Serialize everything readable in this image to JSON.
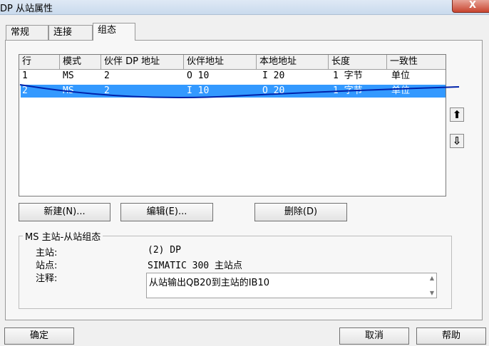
{
  "window": {
    "title": "DP 从站属性",
    "close_label": "X"
  },
  "tabs": [
    "常规",
    "连接",
    "组态"
  ],
  "table": {
    "headers": [
      "行",
      "模式",
      "伙伴 DP 地址",
      "伙伴地址",
      "本地地址",
      "长度",
      "一致性"
    ],
    "rows": [
      [
        "1",
        "MS",
        "2",
        "O 10",
        "I 20",
        "1 字节",
        "单位"
      ],
      [
        "2",
        "MS",
        "2",
        "I 10",
        "O 20",
        "1 字节",
        "单位"
      ]
    ],
    "selected_row": 2
  },
  "side_buttons": {
    "up_label": "⬆",
    "down_label": "⇩"
  },
  "row_buttons": {
    "new_label": "新建(N)...",
    "edit_label": "编辑(E)...",
    "delete_label": "删除(D)"
  },
  "groupbox": {
    "legend": "MS 主站-从站组态",
    "master_label": "主站:",
    "master_value": "(2) DP",
    "station_label": "站点:",
    "station_value": "SIMATIC 300 主站点",
    "comment_label": "注释:",
    "comment_value": "从站输出QB20到主站的IB10"
  },
  "footer": {
    "ok_label": "确定",
    "cancel_label": "取消",
    "help_label": "帮助"
  },
  "colors": {
    "selection": "#3399ff",
    "annotation": "#0022aa"
  }
}
